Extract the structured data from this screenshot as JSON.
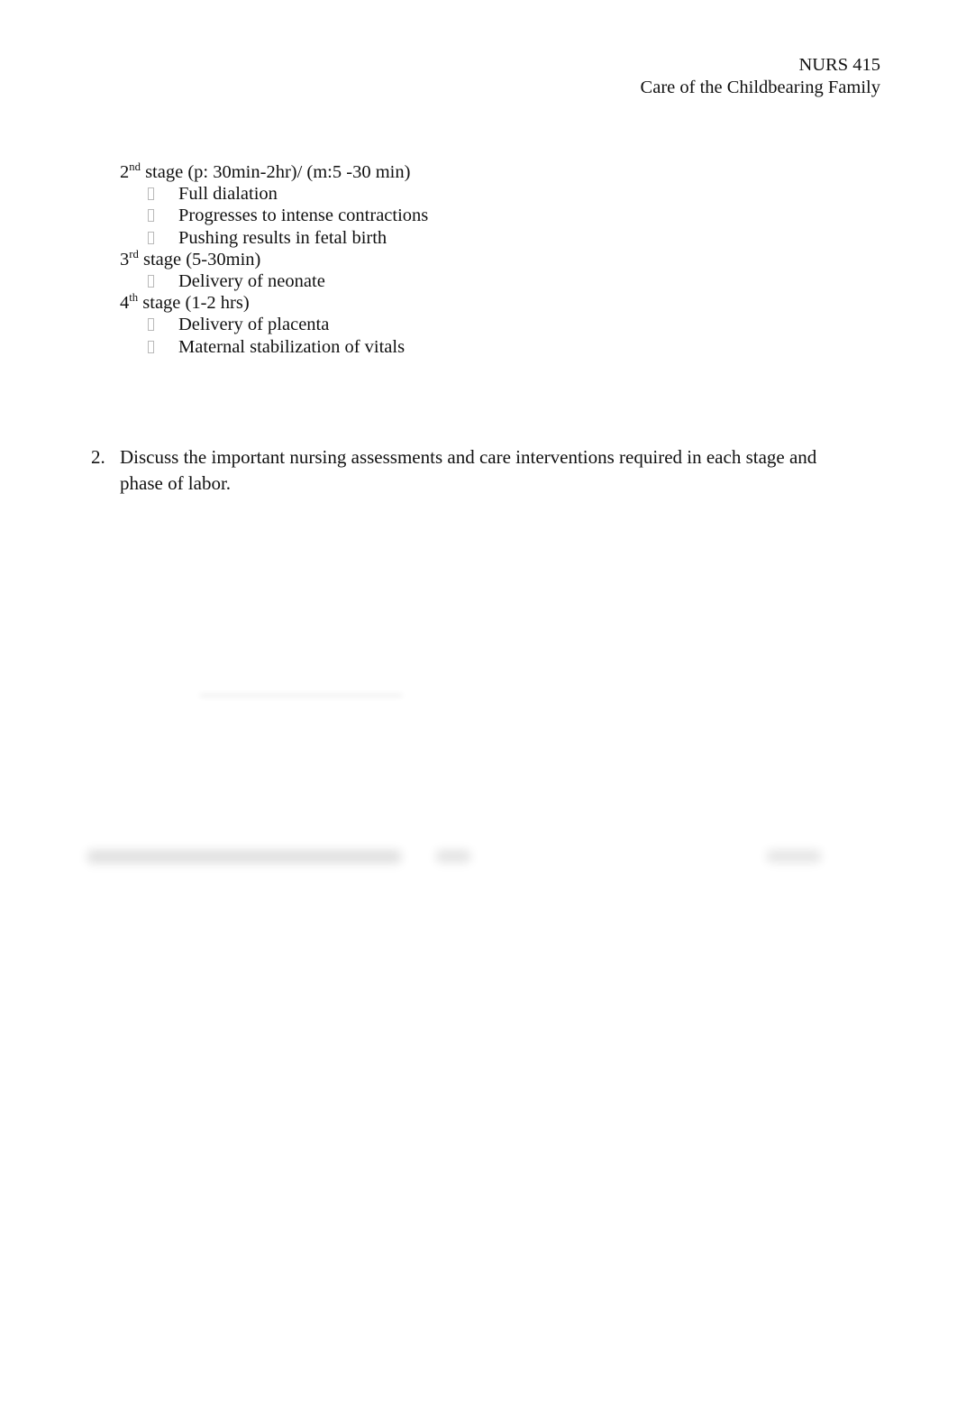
{
  "document": {
    "header": {
      "line1": "NURS 415",
      "line2": "Care of the Childbearing Family"
    },
    "outline": {
      "stages": [
        {
          "ordinal_number": "2",
          "ordinal_suffix": "nd",
          "title_rest": " stage (p: 30min-2hr)/ (m:5 -30 min)",
          "bullets": [
            "Full dialation",
            "Progresses to intense contractions",
            "Pushing results in fetal birth"
          ]
        },
        {
          "ordinal_number": "3",
          "ordinal_suffix": "rd",
          "title_rest": " stage (5-30min)",
          "bullets": [
            "Delivery of neonate"
          ]
        },
        {
          "ordinal_number": "4",
          "ordinal_suffix": "th",
          "title_rest": " stage (1-2 hrs)",
          "bullets": [
            "Delivery of placenta",
            "Maternal stabilization of vitals"
          ]
        }
      ],
      "bullet_glyph": "missing-glyph-box"
    },
    "question": {
      "number": "2.",
      "text": "Discuss the important nursing assessments and care interventions required in each stage and phase of labor."
    },
    "redacted": {
      "note": "blurred illegible content",
      "faint_line_label": "",
      "footer_left_label": "",
      "footer_mid_label": "",
      "footer_right_label": ""
    },
    "colors": {
      "page_background": "#ffffff",
      "text": "#111111",
      "tofu_border": "#b9b9b9"
    }
  }
}
